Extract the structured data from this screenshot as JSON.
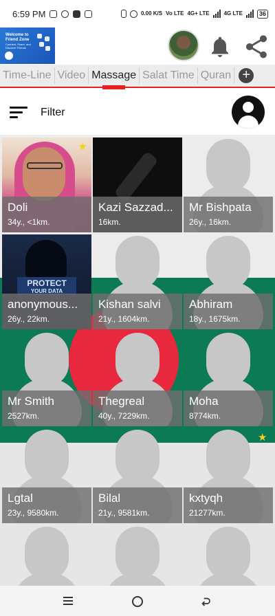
{
  "statusbar": {
    "time": "6:59 PM",
    "net1": "Vo LTE",
    "net2": "4G+ LTE",
    "net3": "4G LTE",
    "speed": "0.00 K/S",
    "battery": "36"
  },
  "banner": {
    "line1": "Welcome to",
    "line2": "Friend Zone",
    "line3": "Connect, Share, and Discover Friends"
  },
  "tabs": [
    {
      "label": "Time-Line"
    },
    {
      "label": "Video"
    },
    {
      "label": "Massage"
    },
    {
      "label": "Salat Time"
    },
    {
      "label": "Quran"
    }
  ],
  "add_tab_label": "+",
  "filter": {
    "label": "Filter"
  },
  "profiles": [
    {
      "name": "Doli",
      "detail": "34y., <1km.",
      "photo": "hijab-woman",
      "starred": true
    },
    {
      "name": "Kazi Sazzad...",
      "detail": "16km.",
      "photo": "tv-remote",
      "starred": false
    },
    {
      "name": "Mr Bishpata",
      "detail": "26y., 16km.",
      "photo": "silhouette",
      "starred": false
    },
    {
      "name": "anonymous...",
      "detail": "26y., 22km.",
      "photo": "protect-your-data",
      "starred": false
    },
    {
      "name": "Kishan salvi",
      "detail": "21y., 1604km.",
      "photo": "silhouette",
      "starred": false
    },
    {
      "name": "Abhiram",
      "detail": "18y., 1675km.",
      "photo": "silhouette",
      "starred": false
    },
    {
      "name": "Mr Smith",
      "detail": "2527km.",
      "photo": "silhouette",
      "starred": false
    },
    {
      "name": "Thegreal",
      "detail": "40y., 7229km.",
      "photo": "silhouette",
      "starred": false
    },
    {
      "name": "Moha",
      "detail": "8774km.",
      "photo": "silhouette",
      "starred": true
    },
    {
      "name": "Lgtal",
      "detail": "23y., 9580km.",
      "photo": "silhouette",
      "starred": false
    },
    {
      "name": "Bilal",
      "detail": "21y., 9581km.",
      "photo": "silhouette",
      "starred": false
    },
    {
      "name": "kxtyqh",
      "detail": "21277km.",
      "photo": "silhouette",
      "starred": false
    }
  ],
  "hacker_image_text": {
    "line1": "PROTECT",
    "line2": "YOUR DATA"
  },
  "colors": {
    "accent": "#e52020",
    "flag_green": "#0b7a55",
    "flag_red": "#e8283d",
    "star": "#f2d21b"
  }
}
